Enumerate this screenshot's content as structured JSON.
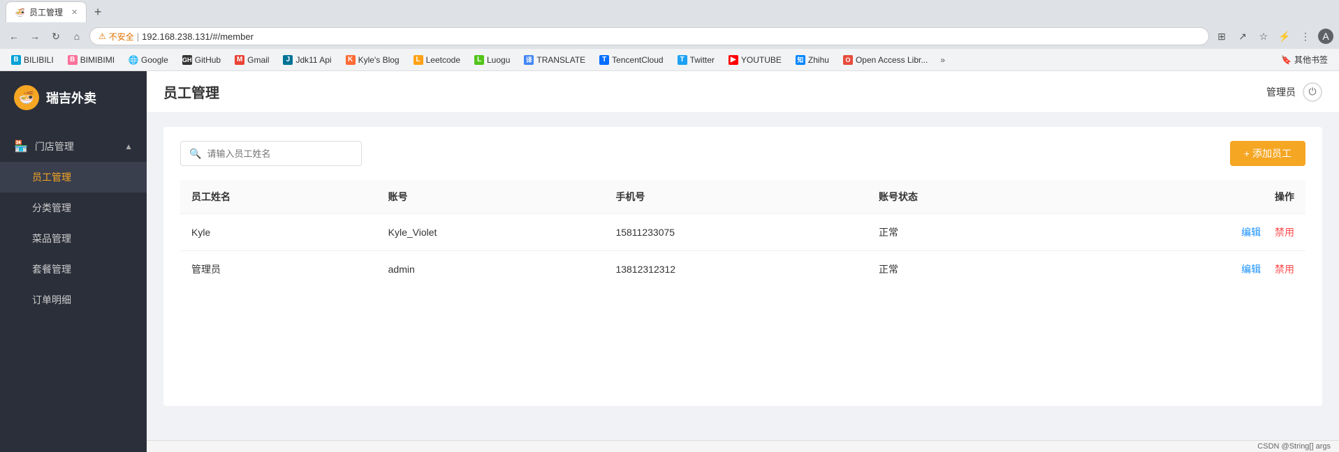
{
  "browser": {
    "address": "192.168.238.131/#/member",
    "security_label": "不安全",
    "tab_title": "员工管理"
  },
  "bookmarks": {
    "items": [
      {
        "label": "BILIBILI",
        "color": "#00a1d6",
        "icon": "B"
      },
      {
        "label": "BIMIBIMI",
        "color": "#fb7299",
        "icon": "B"
      },
      {
        "label": "Google",
        "color": "#4285f4",
        "icon": "G"
      },
      {
        "label": "GitHub",
        "color": "#333",
        "icon": "GH"
      },
      {
        "label": "Gmail",
        "color": "#ea4335",
        "icon": "M"
      },
      {
        "label": "Jdk11 Api",
        "color": "#007396",
        "icon": "J"
      },
      {
        "label": "Kyle's Blog",
        "color": "#ff6b35",
        "icon": "K"
      },
      {
        "label": "Leetcode",
        "color": "#ffa116",
        "icon": "L"
      },
      {
        "label": "Luogu",
        "color": "#52c41a",
        "icon": "L"
      },
      {
        "label": "TRANSLATE",
        "color": "#4285f4",
        "icon": "T"
      },
      {
        "label": "TencentCloud",
        "color": "#006eff",
        "icon": "T"
      },
      {
        "label": "Twitter",
        "color": "#1da1f2",
        "icon": "T"
      },
      {
        "label": "YOUTUBE",
        "color": "#ff0000",
        "icon": "Y"
      },
      {
        "label": "Zhihu",
        "color": "#0084ff",
        "icon": "Z"
      },
      {
        "label": "Open Access Libr...",
        "color": "#e74c3c",
        "icon": "O"
      }
    ],
    "more_label": "»",
    "right_label": "其他书签"
  },
  "sidebar": {
    "logo_text": "瑞吉外卖",
    "logo_emoji": "🍜",
    "section_label": "门店管理",
    "nav_items": [
      {
        "label": "员工管理",
        "active": true
      },
      {
        "label": "分类管理",
        "active": false
      },
      {
        "label": "菜品管理",
        "active": false
      },
      {
        "label": "套餐管理",
        "active": false
      },
      {
        "label": "订单明细",
        "active": false
      }
    ]
  },
  "header": {
    "page_title": "员工管理",
    "admin_label": "管理员"
  },
  "toolbar": {
    "search_placeholder": "请输入员工姓名",
    "add_button_label": "+ 添加员工"
  },
  "table": {
    "columns": [
      "员工姓名",
      "账号",
      "手机号",
      "账号状态",
      "操作"
    ],
    "rows": [
      {
        "name": "Kyle",
        "account": "Kyle_Violet",
        "phone": "15811233075",
        "status": "正常",
        "edit_label": "编辑",
        "disable_label": "禁用"
      },
      {
        "name": "管理员",
        "account": "admin",
        "phone": "13812312312",
        "status": "正常",
        "edit_label": "编辑",
        "disable_label": "禁用"
      }
    ]
  },
  "status_bar": {
    "text": "CSDN @String[] args"
  }
}
